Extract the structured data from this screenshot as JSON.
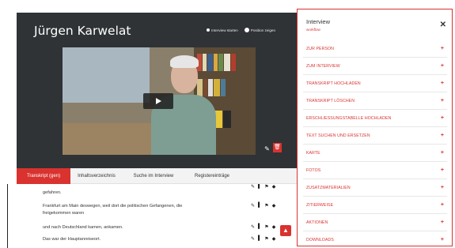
{
  "video_panel": {
    "person_name": "Jürgen Karwelat",
    "toggle": {
      "option1": "Interview starten",
      "option2": "Position zeigen"
    }
  },
  "tabs": [
    {
      "label": "Transkript (gen)",
      "active": true
    },
    {
      "label": "Inhaltsverzeichnis",
      "active": false
    },
    {
      "label": "Suche im Interview",
      "active": false
    },
    {
      "label": "Registereinträge",
      "active": false
    }
  ],
  "transcript": {
    "lines": [
      "gefahren.",
      "Frankfurt am Main deswegen, weil dort die politischen Gefangenen, die",
      "freigekommen waren",
      "und nach Deutschland kamen, ankamen.",
      "Das war der Hauptanreiseort."
    ],
    "action_icons": [
      "pencil-icon",
      "edit-icon",
      "flag-icon",
      "tag-icon"
    ]
  },
  "sidebar": {
    "title": "Interview",
    "subtitle": "workflow",
    "items": [
      "ZUR PERSON",
      "ZUM INTERVIEW",
      "TRANSKRIPT HOCHLADEN",
      "TRANSKRIPT LÖSCHEN",
      "ERSCHLIESSUNGSTABELLE HOCHLADEN",
      "TEXT SUCHEN UND ERSETZEN",
      "KARTE",
      "FOTOS",
      "ZUSATZMATERIALIEN",
      "ZITIERWEISE",
      "AKTIONEN",
      "DOWNLOADS"
    ]
  },
  "colors": {
    "accent": "#d9322f",
    "panel_bg": "#2f3336"
  }
}
